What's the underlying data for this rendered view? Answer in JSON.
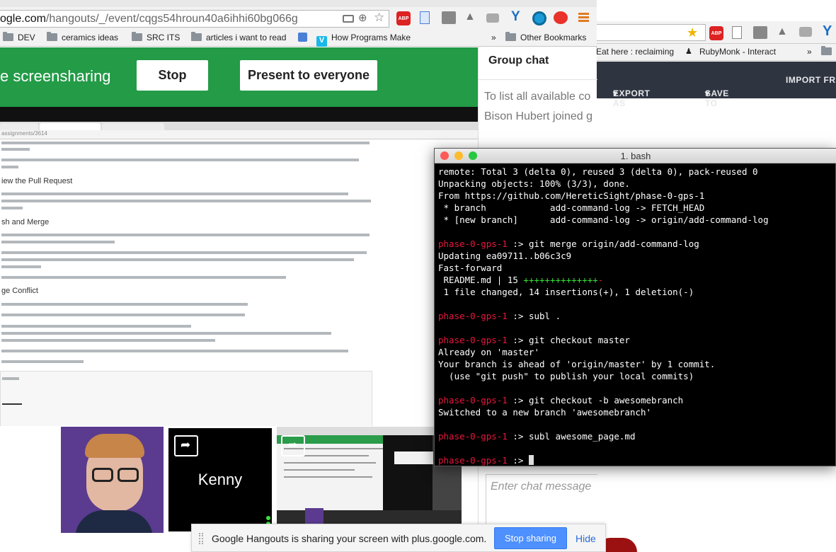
{
  "main_browser": {
    "url_host": "ogle.com",
    "url_path": "/hangouts/_/event/cqgs54hroun40a6ihhi60bg066g",
    "bookmarks": [
      "DEV",
      "ceramics ideas",
      "SRC ITS",
      "articles i want to read",
      "How Programs Make"
    ],
    "other_bookmarks": "Other Bookmarks",
    "more_chevron": "»"
  },
  "back_browser": {
    "bookmarks": [
      "Eat here : reclaiming",
      "RubyMonk - Interact"
    ],
    "more_chevron": "»",
    "toolbar": [
      "EXPORT AS",
      "SAVE TO",
      "IMPORT FRO"
    ]
  },
  "hangout": {
    "sharing_label": "e screensharing",
    "stop_button": "Stop",
    "present_button": "Present to everyone",
    "participant_name": "Kenny",
    "sharing_notice": "Google Hangouts is sharing your screen with plus.google.com.",
    "stop_sharing_button": "Stop sharing",
    "hide_link": "Hide"
  },
  "group_chat": {
    "title": "Group chat",
    "messages": [
      "To list all available co",
      "Bison Hubert joined g"
    ],
    "input_placeholder": "Enter chat message"
  },
  "shared_page": {
    "url": "assignments/3614",
    "headings": [
      "iew the Pull Request",
      "sh and Merge",
      "ge Conflict"
    ]
  },
  "terminal": {
    "title": "1. bash",
    "prompt": "phase-0-gps-1",
    "lines": [
      "remote: Total 3 (delta 0), reused 3 (delta 0), pack-reused 0",
      "Unpacking objects: 100% (3/3), done.",
      "From https://github.com/HereticSight/phase-0-gps-1",
      " * branch            add-command-log -> FETCH_HEAD",
      " * [new branch]      add-command-log -> origin/add-command-log",
      "",
      ":> git merge origin/add-command-log",
      "Updating ea09711..b06c3c9",
      "Fast-forward",
      " README.md | 15 ",
      "++++++++++++++",
      "-",
      " 1 file changed, 14 insertions(+), 1 deletion(-)",
      "",
      ":> subl .",
      "",
      ":> git checkout master",
      "Already on 'master'",
      "Your branch is ahead of 'origin/master' by 1 commit.",
      "  (use \"git push\" to publish your local commits)",
      "",
      ":> git checkout -b awesomebranch",
      "Switched to a new branch 'awesomebranch'",
      "",
      ":> subl awesome_page.md",
      "",
      ":> "
    ]
  },
  "colors": {
    "hangout_green": "#239b47",
    "prompt_red": "#e8173c",
    "diff_green": "#3ae23a",
    "button_blue": "#4d90fe"
  }
}
